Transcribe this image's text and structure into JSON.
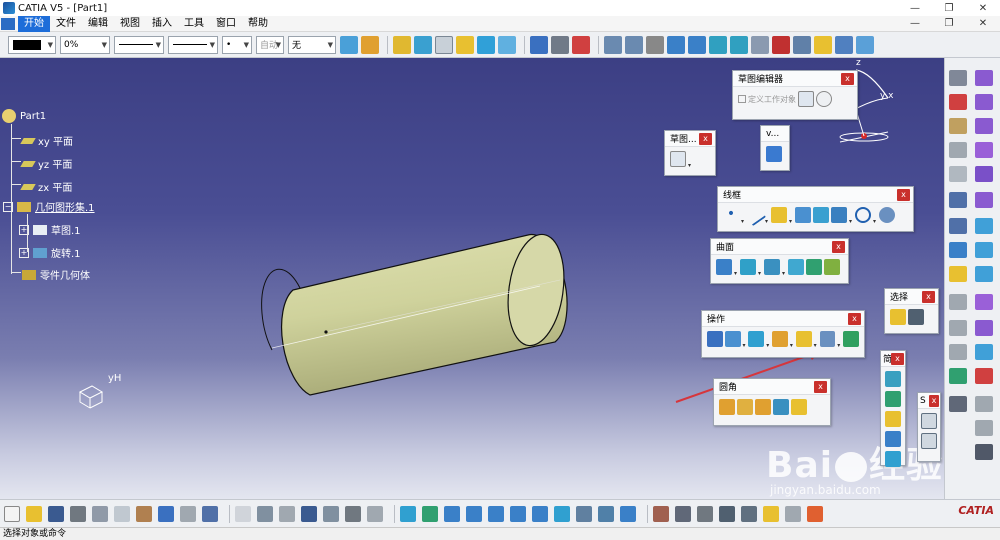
{
  "window": {
    "title": "CATIA V5 - [Part1]",
    "controls": [
      "—",
      "❐",
      "✕"
    ]
  },
  "menubar": {
    "items": [
      "开始",
      "文件",
      "编辑",
      "视图",
      "插入",
      "工具",
      "窗口",
      "帮助"
    ],
    "doc_controls": [
      "—",
      "❐",
      "✕"
    ]
  },
  "toolbar": {
    "transparency": "0%",
    "font_auto": "自动",
    "layer": "无",
    "point_style": "•"
  },
  "tree": {
    "root": "Part1",
    "items": [
      {
        "label": "xy 平面"
      },
      {
        "label": "yz 平面"
      },
      {
        "label": "zx 平面"
      },
      {
        "label": "几何图形集.1"
      },
      {
        "label": "草图.1"
      },
      {
        "label": "旋转.1"
      },
      {
        "label": "零件几何体"
      }
    ]
  },
  "axis_label": "yH",
  "compass_label": "z",
  "compass_yx": "y x",
  "panels": {
    "sketch_editor": {
      "title": "草图编辑器",
      "checkbox": "定义工作对象"
    },
    "sketch": {
      "title": "草图..."
    },
    "v": {
      "title": "v..."
    },
    "wireframe": {
      "title": "线框"
    },
    "surface": {
      "title": "曲面"
    },
    "operation": {
      "title": "操作"
    },
    "select": {
      "title": "选择"
    },
    "fillet": {
      "title": "圆角"
    },
    "narrow1": {
      "title": "简"
    },
    "narrow2": {
      "title": "S"
    },
    "close_label": "x"
  },
  "status": "选择对象或命令",
  "watermark": {
    "brand": "Bai",
    "brand2": "经验",
    "url": "jingyan.baidu.com"
  },
  "catia_logo": "CATIA",
  "colors": {
    "accent": "#1d6dd9",
    "cylinder": "#d4d6a3",
    "close": "#c9302c",
    "arrow": "#d6363c"
  }
}
